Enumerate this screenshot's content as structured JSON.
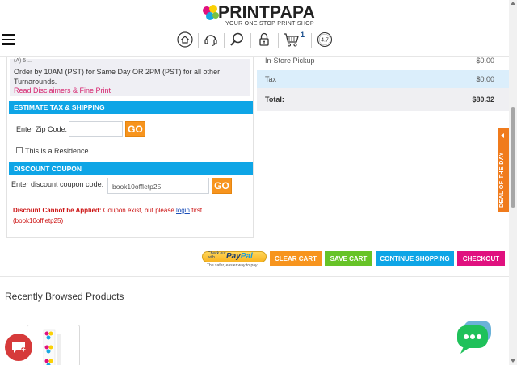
{
  "header": {
    "logo_text": "PRINTPAPA",
    "tagline": "YOUR ONE STOP PRINT SHOP",
    "cart_count": "1",
    "rating": "4.7",
    "icons": [
      "home-icon",
      "support-headset-icon",
      "search-icon",
      "lock-icon",
      "cart-icon",
      "rating-badge-icon"
    ]
  },
  "order_note": {
    "partial_line": "(A) 5 ...",
    "text": "Order by 10AM (PST) for Same Day OR 2PM (PST) for all other Turnarounds.",
    "link": "Read Disclaimers & Fine Print"
  },
  "estimate": {
    "heading": "ESTIMATE TAX & SHIPPING",
    "zip_label": "Enter Zip Code:",
    "zip_value": "",
    "go_label": "GO",
    "residence_label": "This is a Residence"
  },
  "coupon": {
    "heading": "DISCOUNT COUPON",
    "label": "Enter discount coupon code:",
    "value": "book10offletp25",
    "go_label": "GO",
    "error_bold": "Discount Cannot be Applied:",
    "error_text": "Coupon exist, but please",
    "error_link": "login",
    "error_end": "first.",
    "error_code": "(book10offletp25)"
  },
  "totals": {
    "pickup_label": "In-Store Pickup",
    "pickup_value": "$0.00",
    "tax_label": "Tax",
    "tax_value": "$0.00",
    "total_label": "Total:",
    "total_value": "$80.32"
  },
  "actions": {
    "paypal_line1": "Check out",
    "paypal_line2": "with",
    "paypal_brand_a": "Pay",
    "paypal_brand_b": "Pal",
    "paypal_tag": "The safer, easier way to pay",
    "clear_cart": "CLEAR CART",
    "save_cart": "SAVE CART",
    "continue_shopping": "CONTINUE SHOPPING",
    "checkout": "CHECKOUT"
  },
  "recent": {
    "title": "Recently Browsed Products"
  },
  "deal_tab": {
    "label": "DEAL OF THE DAY"
  },
  "colors": {
    "accent_blue": "#0ea5e6",
    "orange": "#f7941d",
    "green": "#67c327",
    "pink": "#e0117f",
    "error_red": "#cc1111"
  }
}
